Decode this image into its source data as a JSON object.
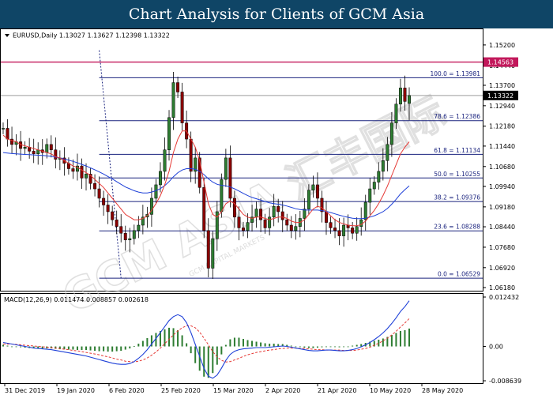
{
  "banner": {
    "title": "Chart Analysis for Clients of GCM Asia"
  },
  "watermark": {
    "text": "GCM ASIA 汇丰国际",
    "subtext": "GCM CAPITAL MARKETS"
  },
  "colors": {
    "banner_bg": "#0f4566",
    "bull": "#2e7d32",
    "bear": "#8b0000",
    "ma_fast": "#e53935",
    "ma_slow": "#1e40d8",
    "fib": "#1a237e",
    "resistance": "#c2185b",
    "current_price_line": "#9e9e9e",
    "macd_hist": "#2e7d32",
    "macd_line": "#1e40d8",
    "signal_line": "#e53935"
  },
  "chart_data": [
    {
      "type": "candlestick",
      "symbol": "EURUSD",
      "timeframe": "Daily",
      "header_text": "EURUSD,Daily  1.13027 1.13627 1.12398 1.13322",
      "ohlc_last": {
        "open": 1.13027,
        "high": 1.13627,
        "low": 1.12398,
        "close": 1.13322
      },
      "current_price_label": "1.13322",
      "resistance_label": "1.14563",
      "resistance": 1.14563,
      "ylim": [
        1.0618,
        1.1552
      ],
      "y_ticks": [
        "1.15200",
        "1.14440",
        "1.13700",
        "1.12940",
        "1.12180",
        "1.11440",
        "1.10680",
        "1.09940",
        "1.09180",
        "1.08440",
        "1.07680",
        "1.06920",
        "1.06180"
      ],
      "x_ticks": [
        "31 Dec 2019",
        "19 Jan 2020",
        "6 Feb 2020",
        "25 Feb 2020",
        "15 Mar 2020",
        "2 Apr 2020",
        "21 Apr 2020",
        "10 May 2020",
        "28 May 2020"
      ],
      "fibonacci": [
        {
          "label": "100.0 = 1.13981",
          "price": 1.13981
        },
        {
          "label": "78.6  = 1.12386",
          "price": 1.12386
        },
        {
          "label": "61.8  = 1.11134",
          "price": 1.11134
        },
        {
          "label": "50.0  = 1.10255",
          "price": 1.10255
        },
        {
          "label": "38.2  = 1.09376",
          "price": 1.09376
        },
        {
          "label": "23.6  = 1.08288",
          "price": 1.08288
        },
        {
          "label": "0.0  = 1.06529",
          "price": 1.06529
        }
      ],
      "closes": [
        1.121,
        1.117,
        1.115,
        1.116,
        1.1135,
        1.114,
        1.1125,
        1.1115,
        1.113,
        1.112,
        1.115,
        1.113,
        1.1095,
        1.11,
        1.108,
        1.106,
        1.105,
        1.107,
        1.1025,
        1.104,
        1.1005,
        1.0985,
        1.095,
        1.0925,
        1.09,
        1.087,
        1.0845,
        1.082,
        1.0795,
        1.08,
        1.083,
        1.085,
        1.088,
        1.089,
        1.095,
        1.1,
        1.105,
        1.113,
        1.125,
        1.138,
        1.1345,
        1.123,
        1.117,
        1.105,
        1.11,
        1.099,
        1.083,
        1.069,
        1.08,
        1.09,
        1.102,
        1.11,
        1.095,
        1.088,
        1.084,
        1.083,
        1.086,
        1.088,
        1.091,
        1.087,
        1.084,
        1.088,
        1.092,
        1.09,
        1.087,
        1.085,
        1.083,
        1.0845,
        1.0875,
        1.091,
        1.098,
        1.1,
        1.095,
        1.09,
        1.086,
        1.084,
        1.083,
        1.081,
        1.085,
        1.084,
        1.082,
        1.0845,
        1.087,
        1.0935,
        1.0985,
        1.101,
        1.105,
        1.109,
        1.115,
        1.123,
        1.13,
        1.136,
        1.131,
        1.1332
      ],
      "ma_fast": [
        1.1185,
        1.117,
        1.1165,
        1.116,
        1.115,
        1.1145,
        1.114,
        1.1135,
        1.113,
        1.1125,
        1.112,
        1.1115,
        1.1105,
        1.11,
        1.109,
        1.108,
        1.107,
        1.1065,
        1.1055,
        1.1045,
        1.1035,
        1.102,
        1.1005,
        1.099,
        1.097,
        1.095,
        1.093,
        1.091,
        1.089,
        1.088,
        1.087,
        1.087,
        1.0875,
        1.0885,
        1.0905,
        1.093,
        1.096,
        1.1,
        1.105,
        1.112,
        1.117,
        1.12,
        1.12,
        1.117,
        1.114,
        1.109,
        1.101,
        1.093,
        1.089,
        1.088,
        1.09,
        1.093,
        1.094,
        1.093,
        1.091,
        1.089,
        1.088,
        1.0875,
        1.088,
        1.088,
        1.0875,
        1.087,
        1.0875,
        1.088,
        1.088,
        1.0875,
        1.0865,
        1.086,
        1.086,
        1.087,
        1.089,
        1.091,
        1.092,
        1.0915,
        1.09,
        1.0885,
        1.087,
        1.086,
        1.0855,
        1.085,
        1.0848,
        1.0848,
        1.0852,
        1.0865,
        1.0885,
        1.0905,
        1.093,
        1.096,
        1.0995,
        1.1035,
        1.1075,
        1.1115,
        1.114,
        1.116
      ],
      "ma_slow": [
        1.112,
        1.1118,
        1.1116,
        1.1115,
        1.1114,
        1.1113,
        1.1112,
        1.1111,
        1.111,
        1.1109,
        1.1108,
        1.1106,
        1.1103,
        1.11,
        1.1096,
        1.1092,
        1.1087,
        1.1082,
        1.1076,
        1.107,
        1.1063,
        1.1056,
        1.1048,
        1.104,
        1.1031,
        1.1022,
        1.1012,
        1.1002,
        1.0992,
        1.0985,
        1.0978,
        1.0973,
        1.097,
        1.097,
        1.0973,
        1.0978,
        1.0986,
        1.0997,
        1.1012,
        1.103,
        1.1045,
        1.1055,
        1.106,
        1.106,
        1.1058,
        1.105,
        1.1038,
        1.1022,
        1.101,
        1.1002,
        1.0998,
        1.0996,
        1.0992,
        1.0985,
        1.0977,
        1.0968,
        1.096,
        1.0953,
        1.0948,
        1.0943,
        1.0938,
        1.0933,
        1.093,
        1.0928,
        1.0925,
        1.0921,
        1.0916,
        1.0911,
        1.0908,
        1.0906,
        1.0906,
        1.0906,
        1.0906,
        1.0904,
        1.0901,
        1.0897,
        1.0892,
        1.0887,
        1.0883,
        1.0879,
        1.0876,
        1.0874,
        1.0874,
        1.0876,
        1.088,
        1.0885,
        1.0892,
        1.09,
        1.0912,
        1.0928,
        1.0946,
        1.0966,
        1.0982,
        1.0996
      ]
    },
    {
      "type": "line",
      "title": "MACD(12,26,9) 0.011474 0.008857 0.002618",
      "params": "12,26,9",
      "values_last": {
        "macd": 0.011474,
        "signal": 0.008857,
        "histogram": 0.002618
      },
      "ylim": [
        -0.008639,
        0.012432
      ],
      "y_ticks": [
        "0.012432",
        "0.00",
        "-0.008639"
      ],
      "macd": [
        0.001,
        0.0008,
        0.0006,
        0.0004,
        0.0002,
        0.0,
        -0.0002,
        -0.0004,
        -0.0005,
        -0.0006,
        -0.0007,
        -0.0008,
        -0.001,
        -0.0012,
        -0.0014,
        -0.0016,
        -0.0018,
        -0.002,
        -0.0022,
        -0.0024,
        -0.0027,
        -0.003,
        -0.0033,
        -0.0036,
        -0.0039,
        -0.0042,
        -0.0044,
        -0.0045,
        -0.0045,
        -0.0043,
        -0.0038,
        -0.003,
        -0.002,
        -0.0008,
        0.0006,
        0.002,
        0.0035,
        0.005,
        0.0065,
        0.0075,
        0.008,
        0.0075,
        0.006,
        0.0035,
        0.0005,
        -0.0025,
        -0.0055,
        -0.0075,
        -0.008,
        -0.0072,
        -0.0055,
        -0.0035,
        -0.002,
        -0.0012,
        -0.0008,
        -0.0006,
        -0.0005,
        -0.0004,
        -0.0003,
        -0.0003,
        -0.0003,
        -0.0002,
        -0.0001,
        0.0,
        0.0001,
        0.0,
        -0.0002,
        -0.0004,
        -0.0006,
        -0.0008,
        -0.001,
        -0.0011,
        -0.0011,
        -0.001,
        -0.0009,
        -0.0009,
        -0.001,
        -0.0011,
        -0.0011,
        -0.001,
        -0.0008,
        -0.0005,
        -0.0001,
        0.0004,
        0.001,
        0.0017,
        0.0025,
        0.0034,
        0.0045,
        0.0058,
        0.0072,
        0.0088,
        0.01,
        0.0115
      ],
      "signal": [
        0.0006,
        0.0006,
        0.0006,
        0.0005,
        0.0004,
        0.0003,
        0.0002,
        0.0001,
        0.0,
        -0.0001,
        -0.0002,
        -0.0003,
        -0.0004,
        -0.0005,
        -0.0007,
        -0.0008,
        -0.001,
        -0.0011,
        -0.0013,
        -0.0015,
        -0.0017,
        -0.0019,
        -0.0021,
        -0.0024,
        -0.0026,
        -0.0029,
        -0.0032,
        -0.0034,
        -0.0037,
        -0.0038,
        -0.0039,
        -0.0037,
        -0.0034,
        -0.0029,
        -0.0022,
        -0.0014,
        -0.0004,
        0.0007,
        0.0018,
        0.0029,
        0.0039,
        0.0047,
        0.0052,
        0.0052,
        0.0047,
        0.0036,
        0.0021,
        0.0004,
        -0.0013,
        -0.0026,
        -0.0035,
        -0.0039,
        -0.0038,
        -0.0034,
        -0.003,
        -0.0025,
        -0.0021,
        -0.0018,
        -0.0015,
        -0.0013,
        -0.0011,
        -0.0009,
        -0.0008,
        -0.0006,
        -0.0005,
        -0.0004,
        -0.0004,
        -0.0004,
        -0.0005,
        -0.0005,
        -0.0006,
        -0.0007,
        -0.0008,
        -0.0008,
        -0.0009,
        -0.0009,
        -0.0009,
        -0.0009,
        -0.001,
        -0.001,
        -0.001,
        -0.0009,
        -0.0007,
        -0.0005,
        -0.0002,
        0.0003,
        0.0008,
        0.0014,
        0.0021,
        0.0029,
        0.0038,
        0.0049,
        0.0059,
        0.007
      ]
    }
  ]
}
